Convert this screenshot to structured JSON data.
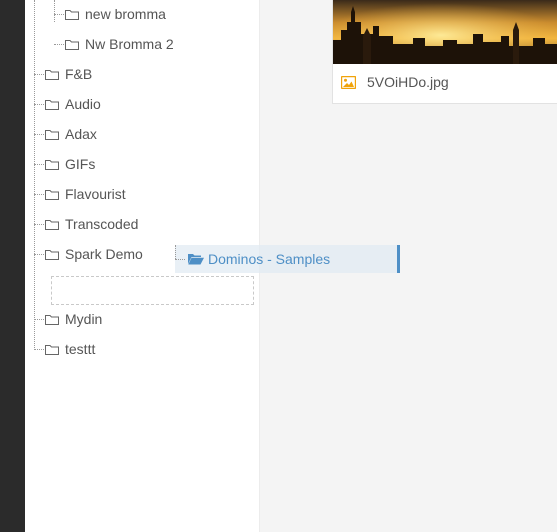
{
  "tree": {
    "nodes": [
      {
        "id": "new-bromma",
        "label": "new bromma"
      },
      {
        "id": "nw-bromma-2",
        "label": "Nw Bromma 2"
      },
      {
        "id": "fnb",
        "label": "F&B"
      },
      {
        "id": "audio",
        "label": "Audio"
      },
      {
        "id": "adax",
        "label": "Adax"
      },
      {
        "id": "gifs",
        "label": "GIFs"
      },
      {
        "id": "flavourist",
        "label": "Flavourist"
      },
      {
        "id": "transcoded",
        "label": "Transcoded"
      },
      {
        "id": "spark-demo",
        "label": "Spark Demo"
      },
      {
        "id": "mydin",
        "label": "Mydin"
      },
      {
        "id": "testtt",
        "label": "testtt"
      }
    ]
  },
  "drag": {
    "label": "Dominos - Samples",
    "icon": "folder-open-icon"
  },
  "asset": {
    "filename": "5VOiHDo.jpg",
    "icon": "image-icon"
  },
  "colors": {
    "accent": "#4e8fc6",
    "image_icon": "#f0a30a",
    "folder_outline": "#666666"
  }
}
